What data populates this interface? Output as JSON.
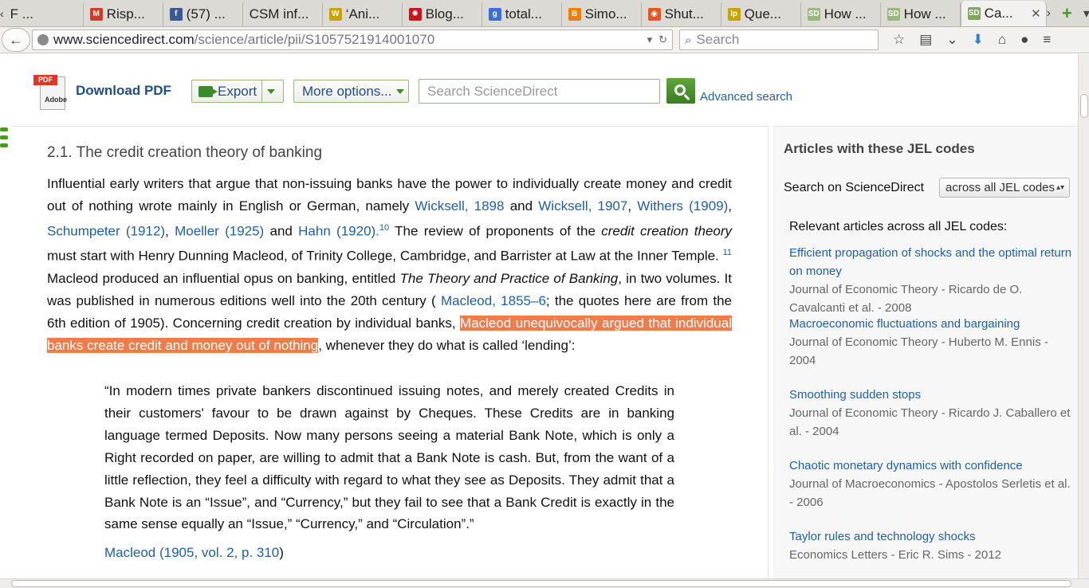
{
  "tabs": [
    {
      "label": "F ...",
      "fav_color": "#f2f1f0",
      "fav_text": ""
    },
    {
      "label": "Risp...",
      "fav_color": "#d33a2c",
      "fav_text": "M"
    },
    {
      "label": "(57) ...",
      "fav_color": "#3b5998",
      "fav_text": "f"
    },
    {
      "label": "CSM inf...",
      "fav_color": "#dcdad5",
      "fav_text": ""
    },
    {
      "label": "‘Ani...",
      "fav_color": "#c9a300",
      "fav_text": "W"
    },
    {
      "label": "Blog...",
      "fav_color": "#c4161c",
      "fav_text": "✺"
    },
    {
      "label": "total...",
      "fav_color": "#3a6fd8",
      "fav_text": "g"
    },
    {
      "label": "Simo...",
      "fav_color": "#f57d00",
      "fav_text": "B"
    },
    {
      "label": "Shut...",
      "fav_color": "#e95420",
      "fav_text": "◉"
    },
    {
      "label": "Que...",
      "fav_color": "#c9a300",
      "fav_text": "lp"
    },
    {
      "label": "How ...",
      "fav_color": "#9ab87e",
      "fav_text": "SD"
    },
    {
      "label": "How ...",
      "fav_color": "#9ab87e",
      "fav_text": "SD"
    },
    {
      "label": "Ca...",
      "fav_color": "#7fa65a",
      "fav_text": "SD"
    }
  ],
  "nav": {
    "url_host": "www.sciencedirect.com",
    "url_path": "/science/article/pii/S1057521914001070",
    "search_placeholder": "Search"
  },
  "toolbar": {
    "pdf_band": "PDF",
    "pdf_adobe": "Adobe",
    "download_pdf": "Download PDF",
    "export": "Export",
    "more_options": "More options...",
    "search_placeholder": "Search ScienceDirect",
    "advanced_search": "Advanced search"
  },
  "article": {
    "section_title": "2.1. The credit creation theory of banking",
    "p1": "Influential early writers that argue that non-issuing banks have the power to individually create money and credit out of nothing wrote mainly in English or German, namely ",
    "cite_wicksell_1898": "Wicksell, 1898",
    "and1": " and ",
    "cite_wicksell_1907": "Wicksell, 1907",
    "comma1": ", ",
    "cite_withers": "Withers (1909)",
    "comma2": ", ",
    "cite_schumpeter": "Schumpeter (1912)",
    "comma3": ", ",
    "cite_moeller": "Moeller (1925)",
    "and2": " and ",
    "cite_hahn": "Hahn (1920).",
    "sup10": "10",
    "p2": " The review of proponents of the ",
    "em1": "credit creation theory",
    "p3": " must start with Henry Dunning Macleod, of Trinity College, Cambridge, and Barrister at Law at the Inner Temple. ",
    "sup11": "11",
    "p4": " Macleod produced an influential opus on banking, entitled ",
    "em2": "The Theory and Practice of Banking",
    "p5": ", in two volumes. It was published in numerous editions well into the 20th century ( ",
    "cite_macleod_1855": "Macleod, 1855–6",
    "p6": "; the quotes here are from the 6th edition of 1905). Concerning credit creation by individual banks, ",
    "highlight": " Macleod unequivocally argued that individual banks create credit and money out of nothing",
    "p7": ", whenever they do what is called ‘lending’:",
    "quote": "“In modern times private bankers discontinued issuing notes, and merely created Credits in their customers' favour to be drawn against by Cheques. These Credits are in banking language termed Deposits. Now many persons seeing a material Bank Note, which is only a Right recorded on paper, are willing to admit that a Bank Note is cash. But, from the want of a little reflection, they feel a difficulty with regard to what they see as Deposits. They admit that a Bank Note is an “Issue”, and “Currency,” but they fail to see that a Bank Credit is exactly in the same sense equally an “Issue,” “Currency,” and “Circulation”.”",
    "quote_cite": "Macleod (1905, vol. 2, p. 310",
    "quote_cite_close": ")"
  },
  "sidebar": {
    "title": "Articles with these JEL codes",
    "search_label": "Search on ScienceDirect",
    "select_value": "across all JEL codes",
    "relevant_label": "Relevant articles across all JEL codes:",
    "items": [
      {
        "title": "Efficient propagation of shocks and the optimal return on money",
        "meta": "Journal of Economic Theory - Ricardo de O. Cavalcanti et al. - 2008"
      },
      {
        "title": "Macroeconomic fluctuations and bargaining",
        "meta": "Journal of Economic Theory - Huberto M. Ennis - 2004"
      },
      {
        "title": "Smoothing sudden stops",
        "meta": "Journal of Economic Theory - Ricardo J. Caballero et al. - 2004"
      },
      {
        "title": "Chaotic monetary dynamics with confidence",
        "meta": "Journal of Macroeconomics - Apostolos Serletis et al. - 2006"
      },
      {
        "title": "Taylor rules and technology shocks",
        "meta": "Economics Letters - Eric R. Sims - 2012"
      }
    ]
  }
}
